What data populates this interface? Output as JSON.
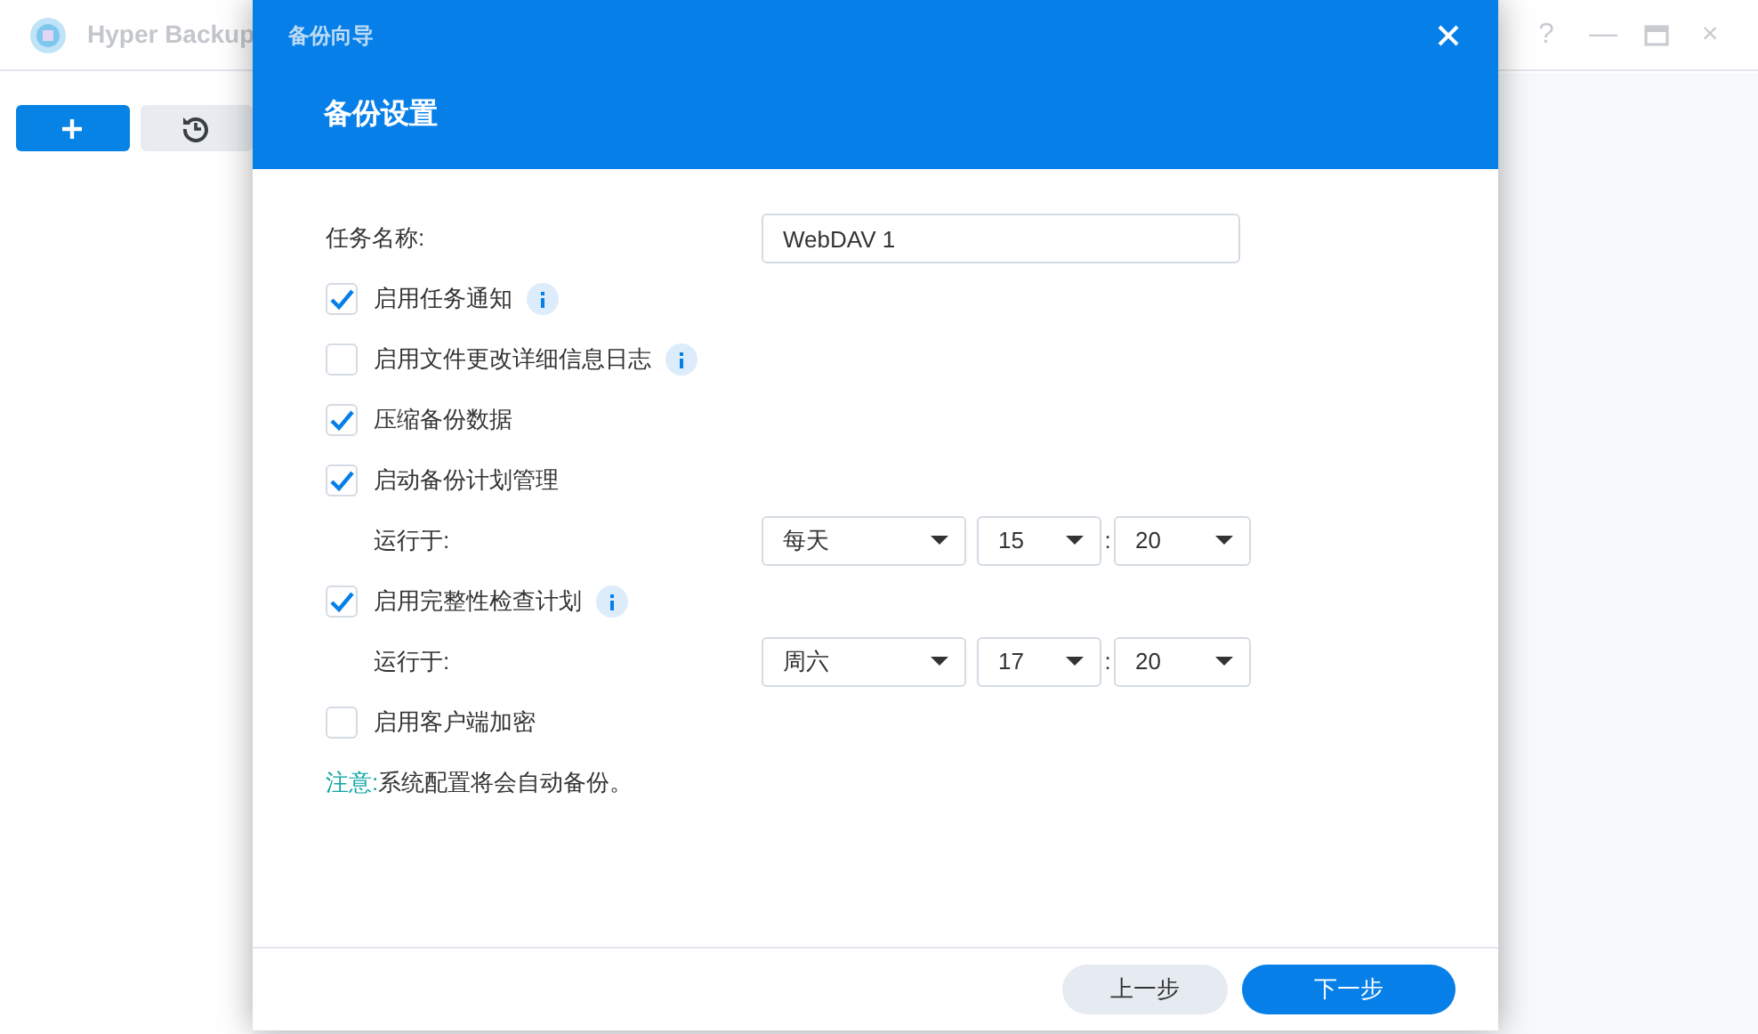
{
  "app": {
    "title": "Hyper Backup",
    "window_controls": [
      "?",
      "—",
      "×"
    ]
  },
  "dialog": {
    "title": "备份向导",
    "heading": "备份设置",
    "fields": [
      {
        "kind": "text",
        "label": "任务名称:",
        "value": "WebDAV 1"
      },
      {
        "kind": "checkbox",
        "label": "启用任务通知",
        "checked": true,
        "info": true
      },
      {
        "kind": "checkbox",
        "label": "启用文件更改详细信息日志",
        "checked": false,
        "info": true
      },
      {
        "kind": "checkbox",
        "label": "压缩备份数据",
        "checked": true,
        "info": false
      },
      {
        "kind": "checkbox",
        "label": "启动备份计划管理",
        "checked": true,
        "info": false
      },
      {
        "kind": "schedule",
        "label": "运行于:",
        "period": "每天",
        "hour": "15",
        "separator": ":",
        "minute": "20"
      },
      {
        "kind": "checkbox",
        "label": "启用完整性检查计划",
        "checked": true,
        "info": true
      },
      {
        "kind": "schedule",
        "label": "运行于:",
        "period": "周六",
        "hour": "17",
        "separator": ":",
        "minute": "20"
      },
      {
        "kind": "checkbox",
        "label": "启用客户端加密",
        "checked": false,
        "info": false
      }
    ],
    "note": {
      "label": "注意:",
      "text": "系统配置将会自动备份。"
    },
    "buttons": [
      {
        "label": "上一步",
        "kind": "secondary"
      },
      {
        "label": "下一步",
        "kind": "primary"
      }
    ]
  }
}
